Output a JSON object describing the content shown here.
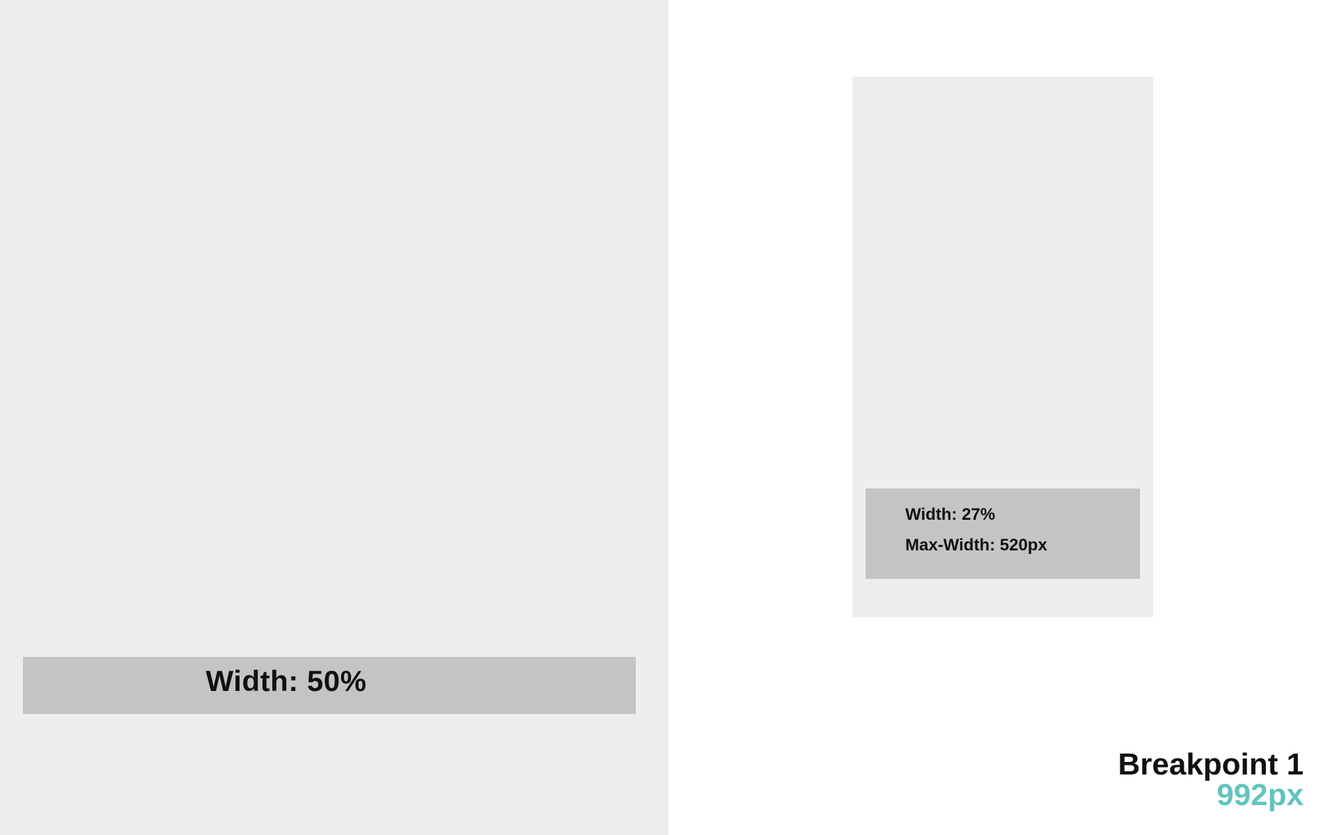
{
  "left": {
    "bar_label": "Width: 50%"
  },
  "phone": {
    "width_label": "Width: 27%",
    "max_width_label": "Max-Width: 520px"
  },
  "breakpoint": {
    "title": "Breakpoint 1",
    "size": "992px",
    "size_color": "#63c3bd"
  },
  "colors": {
    "panel_bg": "#eeeeee",
    "bar_bg": "#c4c4c4",
    "page_bg": "#ffffff",
    "text": "#111111"
  }
}
